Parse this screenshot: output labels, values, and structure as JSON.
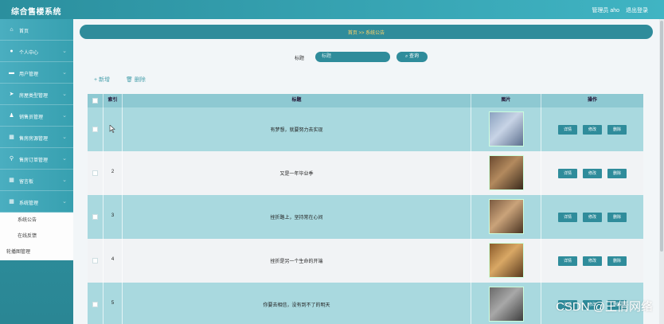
{
  "app": {
    "title": "综合售楼系统",
    "user_text": "管理员 aho",
    "logout": "退出登录"
  },
  "sidebar": {
    "items": [
      {
        "label": "首页",
        "icon": "home-icon"
      },
      {
        "label": "个人中心",
        "icon": "user-icon"
      },
      {
        "label": "用户管理",
        "icon": "list-icon"
      },
      {
        "label": "房屋类型管理",
        "icon": "send-icon"
      },
      {
        "label": "销售员管理",
        "icon": "person-icon"
      },
      {
        "label": "售房房源管理",
        "icon": "grid-icon"
      },
      {
        "label": "售房订单管理",
        "icon": "pin-icon"
      },
      {
        "label": "留言板",
        "icon": "grid-icon"
      },
      {
        "label": "系统管理",
        "icon": "grid-icon"
      }
    ],
    "submenu": [
      "系统公告",
      "在线反馈",
      "轮播图管理"
    ]
  },
  "breadcrumb": {
    "text": "首页 >> 系统公告"
  },
  "search": {
    "label": "标题",
    "placeholder": "标题",
    "button": "查询"
  },
  "actions": {
    "add": "+ 新增",
    "delete": "删除"
  },
  "table": {
    "columns": [
      "",
      "索引",
      "标题",
      "图片",
      "操作"
    ],
    "rows": [
      {
        "index": "",
        "title": "有梦想，就要努力去实现"
      },
      {
        "index": "2",
        "title": "又是一年毕业季"
      },
      {
        "index": "3",
        "title": "挫折路上，坚持常在心间"
      },
      {
        "index": "4",
        "title": "挫折是另一个生命的开端"
      },
      {
        "index": "5",
        "title": "你要去相信，没有到不了的明天"
      }
    ],
    "ops": [
      "详情",
      "修改",
      "删除"
    ]
  },
  "watermark": "CSDN @王倩网络",
  "colors": {
    "primary": "#2f8c9b",
    "header": "#40b4c3",
    "row_odd": "#a9d9df",
    "row_even": "#f1f3f5",
    "crumb_text": "#ffd36a"
  }
}
